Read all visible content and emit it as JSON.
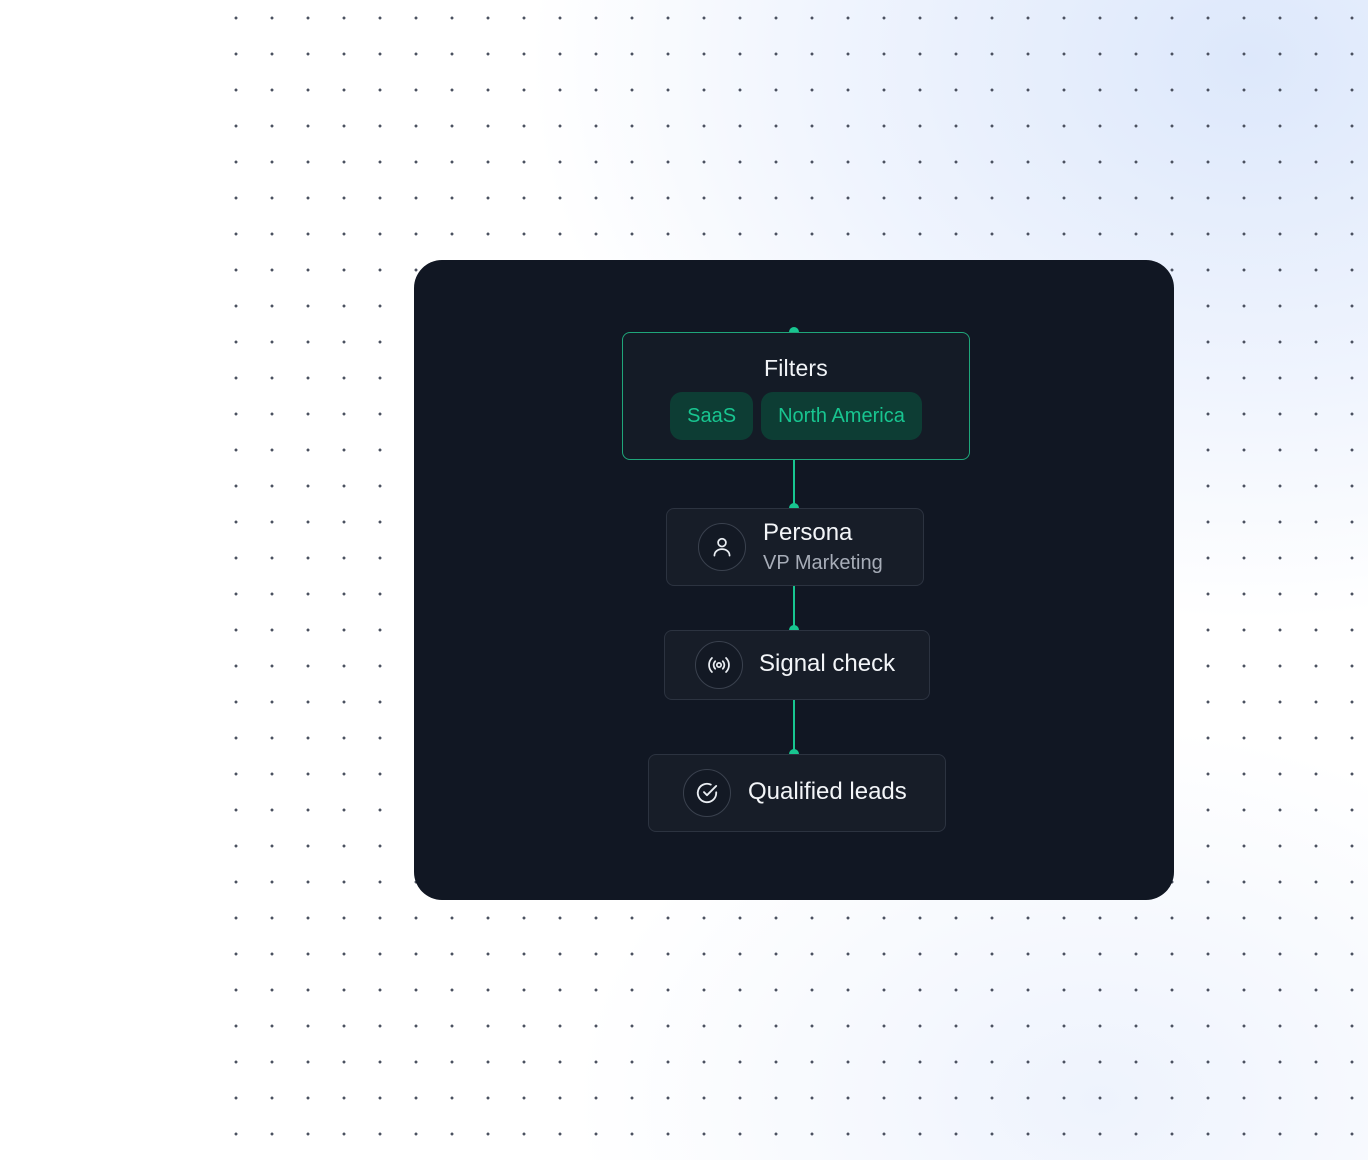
{
  "colors": {
    "card_background": "#111723",
    "accent_green": "#18c590",
    "tag_background": "#0d3d34",
    "node_border": "#2c3340",
    "filters_border": "#1fa67a",
    "dot_color": "#4b5160"
  },
  "flow": {
    "filters": {
      "title": "Filters",
      "tags": [
        "SaaS",
        "North America"
      ]
    },
    "persona": {
      "icon": "user-icon",
      "title": "Persona",
      "subtitle": "VP Marketing"
    },
    "signal_check": {
      "icon": "broadcast-signal-icon",
      "title": "Signal check"
    },
    "qualified_leads": {
      "icon": "check-circle-icon",
      "title": "Qualified leads"
    }
  }
}
